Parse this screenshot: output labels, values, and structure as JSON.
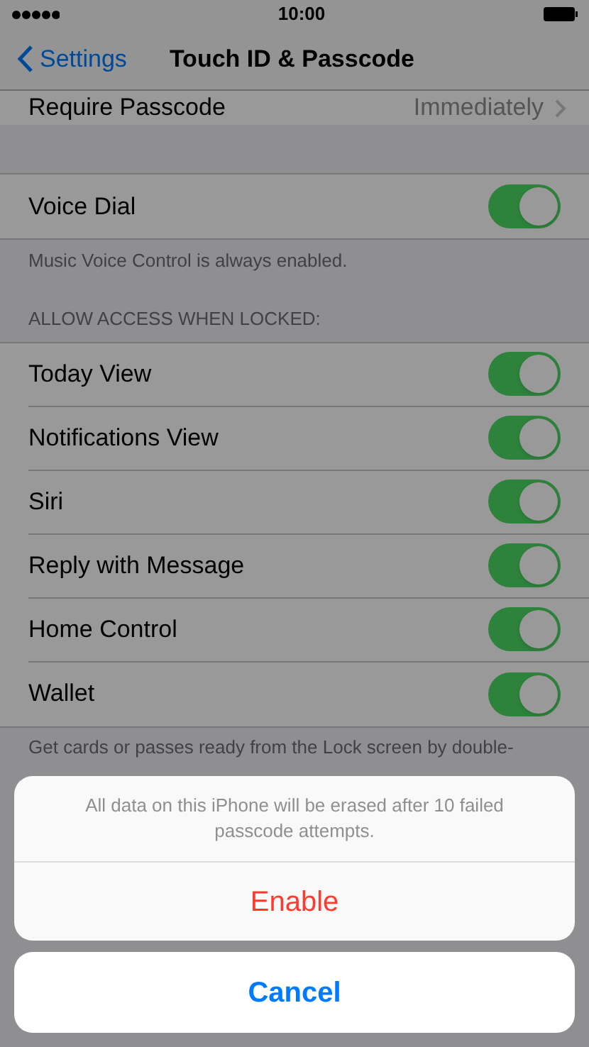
{
  "status_bar": {
    "time": "10:00"
  },
  "nav": {
    "back": "Settings",
    "title": "Touch ID & Passcode"
  },
  "require_passcode": {
    "label": "Require Passcode",
    "value": "Immediately"
  },
  "voice_group": {
    "rows": [
      {
        "label": "Voice Dial",
        "on": true
      }
    ],
    "footer": "Music Voice Control is always enabled."
  },
  "locked_group": {
    "header": "ALLOW ACCESS WHEN LOCKED:",
    "rows": [
      {
        "label": "Today View",
        "on": true
      },
      {
        "label": "Notifications View",
        "on": true
      },
      {
        "label": "Siri",
        "on": true
      },
      {
        "label": "Reply with Message",
        "on": true
      },
      {
        "label": "Home Control",
        "on": true
      },
      {
        "label": "Wallet",
        "on": true
      }
    ],
    "footer": "Get cards or passes ready from the Lock screen by double-"
  },
  "action_sheet": {
    "message": "All data on this iPhone will be erased after 10 failed passcode attempts.",
    "actions": [
      {
        "label": "Enable",
        "kind": "destructive"
      }
    ],
    "cancel": "Cancel"
  }
}
